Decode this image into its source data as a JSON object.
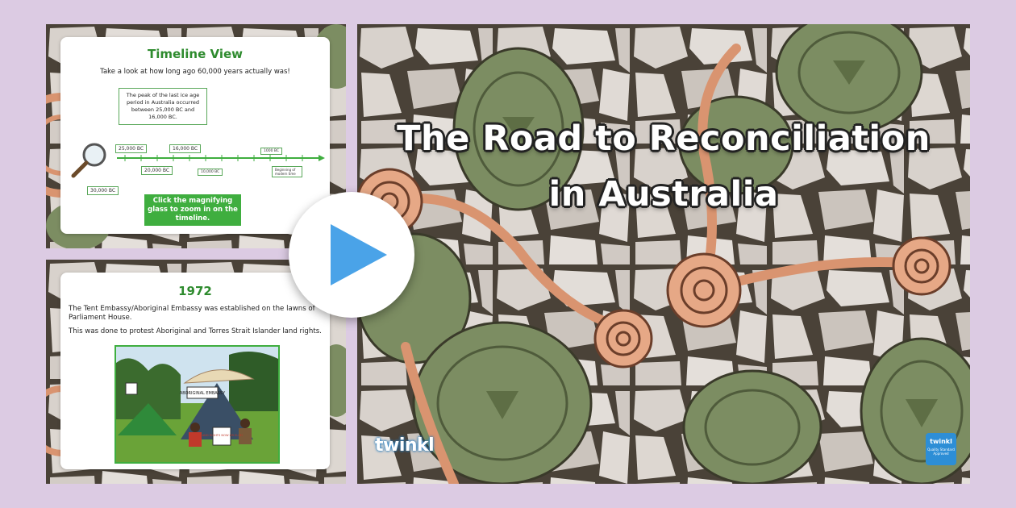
{
  "slide1": {
    "title": "Timeline View",
    "subtitle": "Take a look at how long ago 60,000 years actually was!",
    "callout": "The peak of the last ice age period in Australia occurred between 25,000 BC and 16,000 BC.",
    "labels": [
      "25,000 BC",
      "16,000 BC",
      "20,000 BC",
      "30,000 BC",
      "10,000 BC",
      "1000 BC",
      "Beginning of modern time"
    ],
    "button": "Click the magnifying glass to zoom in on the timeline."
  },
  "slide2": {
    "title": "1972",
    "para1": "The Tent Embassy/Aboriginal Embassy was established on the lawns of Parliament House.",
    "para2": "This was done to protest Aboriginal and Torres Strait Islander land rights.",
    "sign1": "ABORIGINAL EMBASSY",
    "sign2": "LAND RIGHTS NOW OR ELSE!"
  },
  "main": {
    "title_line1": "The Road to Reconciliation",
    "title_line2": "in Australia",
    "logo": "twinkl",
    "badge": "twinkl",
    "badge_sub": "Quality Standard Approved"
  },
  "icons": [
    "play-icon",
    "magnifying-glass-icon",
    "twinkl-logo",
    "quality-badge-icon"
  ],
  "colors": {
    "background": "#dccbe3",
    "accent_green": "#2e8b2e",
    "play_blue": "#4aa3e8",
    "path_orange": "#d99470",
    "stone_green": "#7c8d62"
  }
}
